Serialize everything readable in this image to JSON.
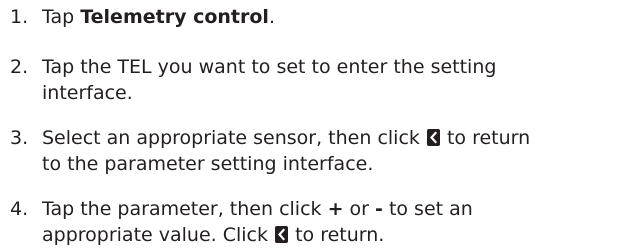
{
  "steps": [
    {
      "number": "1.",
      "text_before": "Tap ",
      "bold": "Telemetry control",
      "text_after": "."
    },
    {
      "number": "2.",
      "line1": "Tap the TEL you want to set to enter the setting",
      "line2": "interface."
    },
    {
      "number": "3.",
      "line1_before_icon": "Select an appropriate sensor,  then click ",
      "line1_after_icon": " to return",
      "line2": "to the parameter setting interface.",
      "icon": "back-chevron-icon"
    },
    {
      "number": "4.",
      "line1_a": "Tap the parameter, then click ",
      "plus": "+",
      "line1_b": " or ",
      "minus": "-",
      "line1_c": " to set an",
      "line2_before_icon": "appropriate value. Click ",
      "line2_after_icon": " to return.",
      "icon": "back-chevron-icon"
    }
  ]
}
